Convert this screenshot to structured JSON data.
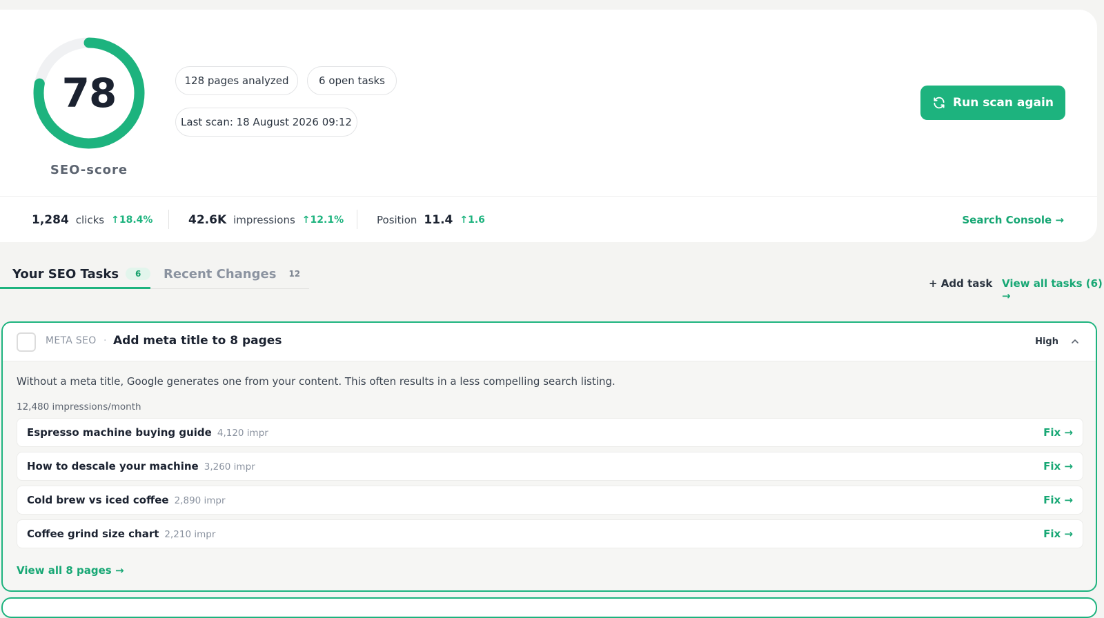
{
  "score": {
    "value": "78",
    "label": "SEO-score",
    "fraction": 0.78,
    "color": "#1db37e"
  },
  "pills": {
    "pages": "128 pages analyzed",
    "tasks": "6 open tasks",
    "last_scan": "Last scan: 18 August 2026 09:12"
  },
  "run_button": {
    "label": "Run scan again",
    "icon": "refresh-icon"
  },
  "metrics": {
    "clicks": {
      "value": "1,284",
      "label": "clicks",
      "change": "18.4%"
    },
    "impressions": {
      "value": "42.6K",
      "label": "impressions",
      "change": "12.1%"
    },
    "position": {
      "label": "Position",
      "value": "11.4",
      "change": "1.6"
    }
  },
  "search_console": "Search Console →",
  "tabs": [
    {
      "label": "Your SEO Tasks",
      "count": "6"
    },
    {
      "label": "Recent Changes",
      "count": "12"
    }
  ],
  "actions": {
    "add_task": "+ Add task",
    "view_all": "View all tasks (6) →"
  },
  "task": {
    "category": "META SEO",
    "separator": "·",
    "title": "Add meta title to 8 pages",
    "priority": "High",
    "description": "Without a meta title, Google generates one from your content. This often results in a less compelling search listing.",
    "impressions": "12,480 impressions/month",
    "pages": [
      {
        "title": "Espresso machine buying guide",
        "impr": "4,120 impr",
        "fix": "Fix →"
      },
      {
        "title": "How to descale your machine",
        "impr": "3,260 impr",
        "fix": "Fix →"
      },
      {
        "title": "Cold brew vs iced coffee",
        "impr": "2,890 impr",
        "fix": "Fix →"
      },
      {
        "title": "Coffee grind size chart",
        "impr": "2,210 impr",
        "fix": "Fix →"
      }
    ],
    "view_pages": "View all 8 pages →"
  }
}
